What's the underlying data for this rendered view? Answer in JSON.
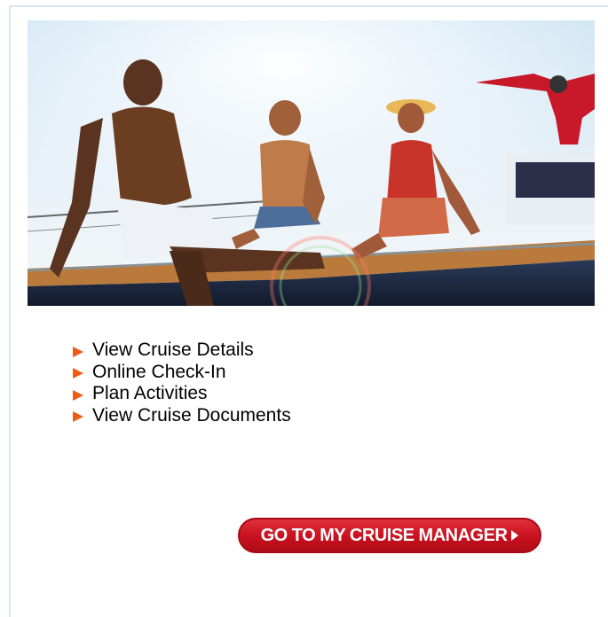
{
  "links": [
    {
      "label": "View Cruise Details",
      "icon": "orange-arrow-icon"
    },
    {
      "label": "Online Check-In",
      "icon": "orange-arrow-icon"
    },
    {
      "label": "Plan Activities",
      "icon": "orange-arrow-icon"
    },
    {
      "label": "View Cruise Documents",
      "icon": "orange-arrow-icon"
    }
  ],
  "cta": {
    "label": "GO TO MY CRUISE MANAGER",
    "icon": "chevron-right-icon"
  },
  "colors": {
    "accent_arrow": "#f05a14",
    "cta_red": "#c8101e",
    "panel_border": "#d6e6f2"
  }
}
